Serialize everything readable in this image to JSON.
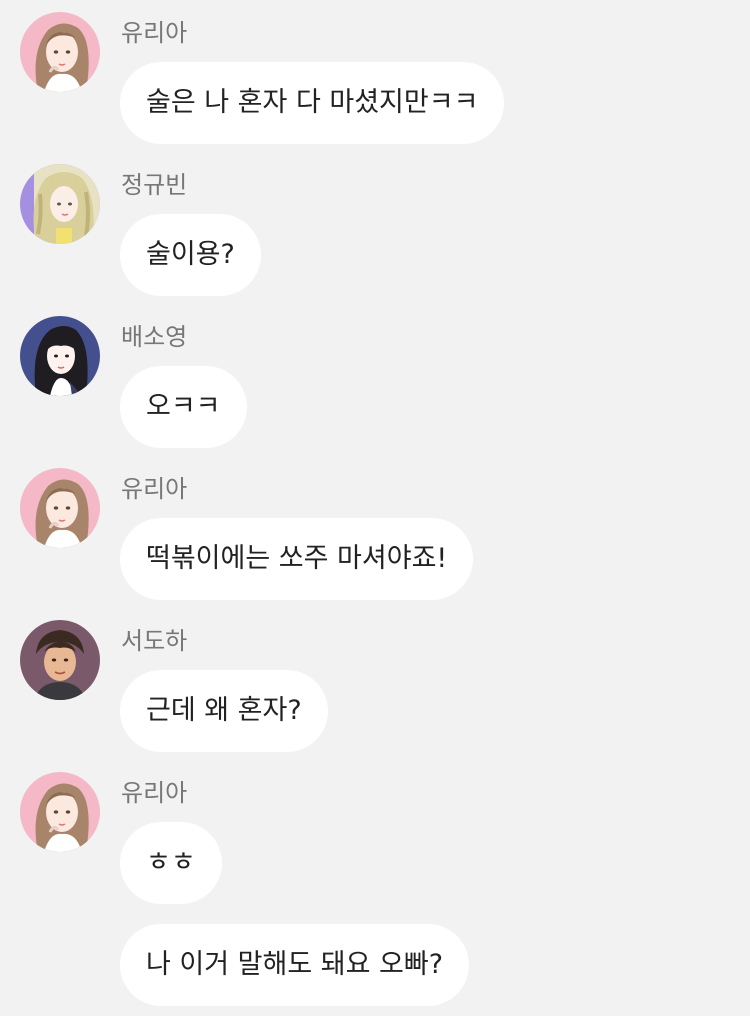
{
  "colors": {
    "background": "#f2f2f2",
    "bubble": "#ffffff",
    "sender_name": "#777777",
    "message_text": "#222222"
  },
  "messages": [
    {
      "sender": "유리아",
      "avatar": "yuria-avatar",
      "text": "술은 나 혼자 다 마셨지만ㅋㅋ"
    },
    {
      "sender": "정규빈",
      "avatar": "jeonggyubin-avatar",
      "text": "술이용?"
    },
    {
      "sender": "배소영",
      "avatar": "baesoyoung-avatar",
      "text": "오ㅋㅋ"
    },
    {
      "sender": "유리아",
      "avatar": "yuria-avatar",
      "text": "떡볶이에는 쏘주 마셔야죠!"
    },
    {
      "sender": "서도하",
      "avatar": "seodoha-avatar",
      "text": "근데 왜 혼자?"
    },
    {
      "sender": "유리아",
      "avatar": "yuria-avatar",
      "text": "ㅎㅎ"
    },
    {
      "sender": "유리아",
      "avatar": "",
      "text": "나 이거 말해도 돼요 오빠?"
    }
  ]
}
